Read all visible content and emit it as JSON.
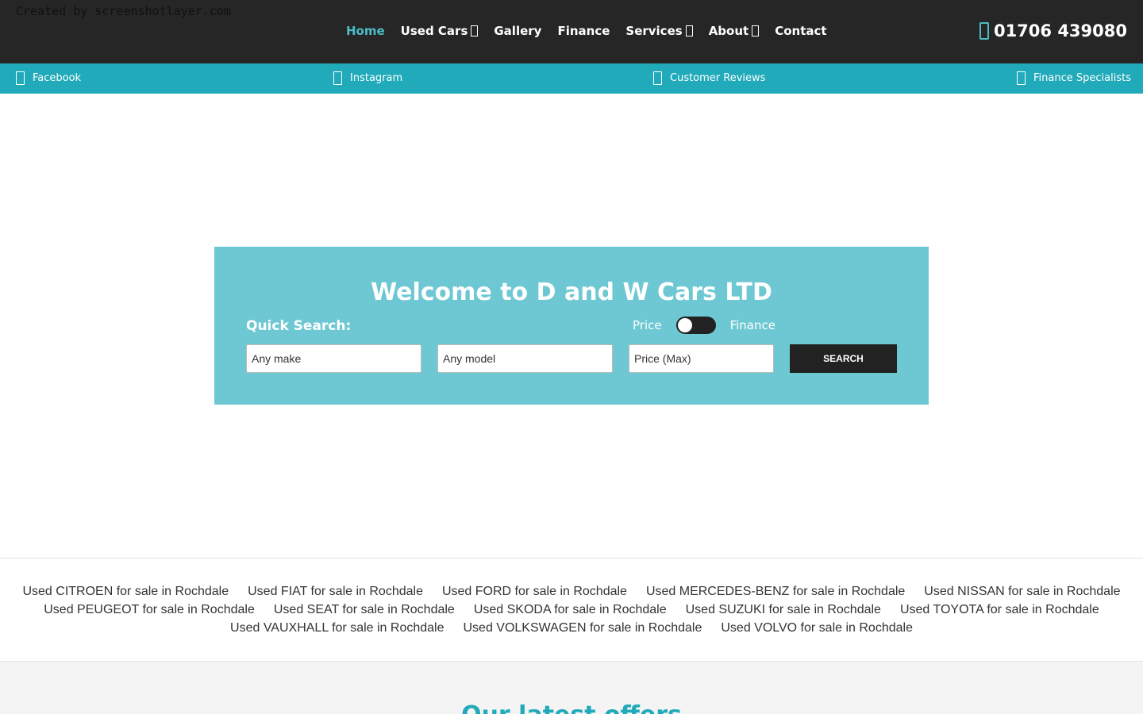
{
  "watermark": "Created by screenshotlayer.com",
  "nav": {
    "items": [
      {
        "label": "Home",
        "active": true,
        "dropdown": false
      },
      {
        "label": "Used Cars",
        "active": false,
        "dropdown": true
      },
      {
        "label": "Gallery",
        "active": false,
        "dropdown": false
      },
      {
        "label": "Finance",
        "active": false,
        "dropdown": false
      },
      {
        "label": "Services",
        "active": false,
        "dropdown": true
      },
      {
        "label": "About",
        "active": false,
        "dropdown": true
      },
      {
        "label": "Contact",
        "active": false,
        "dropdown": false
      }
    ],
    "phone": "01706 439080",
    "phone_icon": "phone-icon"
  },
  "subnav": {
    "links": [
      {
        "label": "Facebook",
        "icon": "facebook-icon"
      },
      {
        "label": "Instagram",
        "icon": "instagram-icon"
      },
      {
        "label": "Customer Reviews",
        "icon": "reviews-icon"
      },
      {
        "label": "Finance Specialists",
        "icon": "finance-icon"
      }
    ]
  },
  "hero": {
    "title": "Welcome to D and W Cars LTD",
    "quick_search_label": "Quick Search:",
    "toggle_left": "Price",
    "toggle_right": "Finance",
    "make_value": "Any make",
    "model_value": "Any model",
    "price_value": "Price (Max)",
    "search_label": "SEARCH"
  },
  "makes": {
    "rows": [
      [
        "Used CITROEN for sale in Rochdale",
        "Used FIAT for sale in Rochdale",
        "Used FORD for sale in Rochdale",
        "Used MERCEDES-BENZ for sale in Rochdale",
        "Used NISSAN for sale in Rochdale"
      ],
      [
        "Used PEUGEOT for sale in Rochdale",
        "Used SEAT for sale in Rochdale",
        "Used SKODA for sale in Rochdale",
        "Used SUZUKI for sale in Rochdale",
        "Used TOYOTA for sale in Rochdale"
      ],
      [
        "Used VAUXHALL for sale in Rochdale",
        "Used VOLKSWAGEN for sale in Rochdale",
        "Used VOLVO for sale in Rochdale"
      ]
    ]
  },
  "offers": {
    "title": "Our latest offers"
  },
  "colors": {
    "accent": "#21aab9",
    "hero_bg": "#6ec8d3",
    "topbar_bg": "#262626"
  }
}
